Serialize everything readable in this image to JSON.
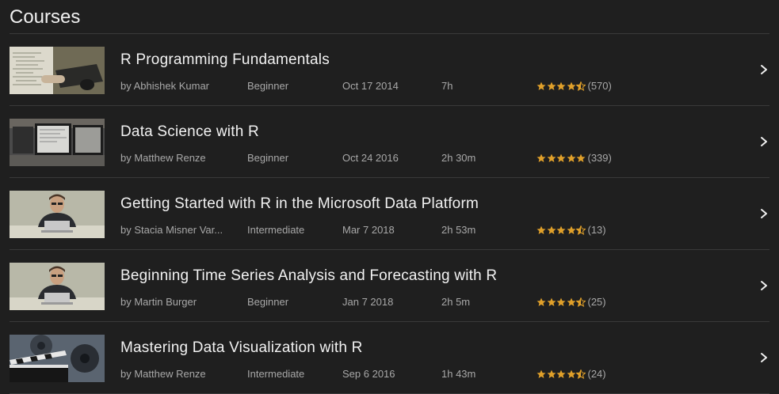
{
  "header": {
    "title": "Courses"
  },
  "colors": {
    "star": "#e0a02a",
    "text": "#f2f2f2",
    "meta": "#a8a8a8",
    "divider": "#3a3a3a",
    "background": "#1f1f1f"
  },
  "courses": [
    {
      "title": "R Programming Fundamentals",
      "author": "by Abhishek Kumar",
      "level": "Beginner",
      "date": "Oct 17 2014",
      "duration": "7h",
      "rating": 4.5,
      "rating_count": "(570)",
      "thumb": "code-laptop"
    },
    {
      "title": "Data Science with R",
      "author": "by Matthew Renze",
      "level": "Beginner",
      "date": "Oct 24 2016",
      "duration": "2h 30m",
      "rating": 5,
      "rating_count": "(339)",
      "thumb": "monitors"
    },
    {
      "title": "Getting Started with R in the Microsoft Data Platform",
      "author": "by Stacia Misner Var...",
      "level": "Intermediate",
      "date": "Mar 7 2018",
      "duration": "2h 53m",
      "rating": 4.5,
      "rating_count": "(13)",
      "thumb": "person-laptop"
    },
    {
      "title": "Beginning Time Series Analysis and Forecasting with R",
      "author": "by Martin Burger",
      "level": "Beginner",
      "date": "Jan 7 2018",
      "duration": "2h 5m",
      "rating": 4.5,
      "rating_count": "(25)",
      "thumb": "person-laptop"
    },
    {
      "title": "Mastering Data Visualization with R",
      "author": "by Matthew Renze",
      "level": "Intermediate",
      "date": "Sep 6 2016",
      "duration": "1h 43m",
      "rating": 4.5,
      "rating_count": "(24)",
      "thumb": "film-clapper"
    }
  ]
}
